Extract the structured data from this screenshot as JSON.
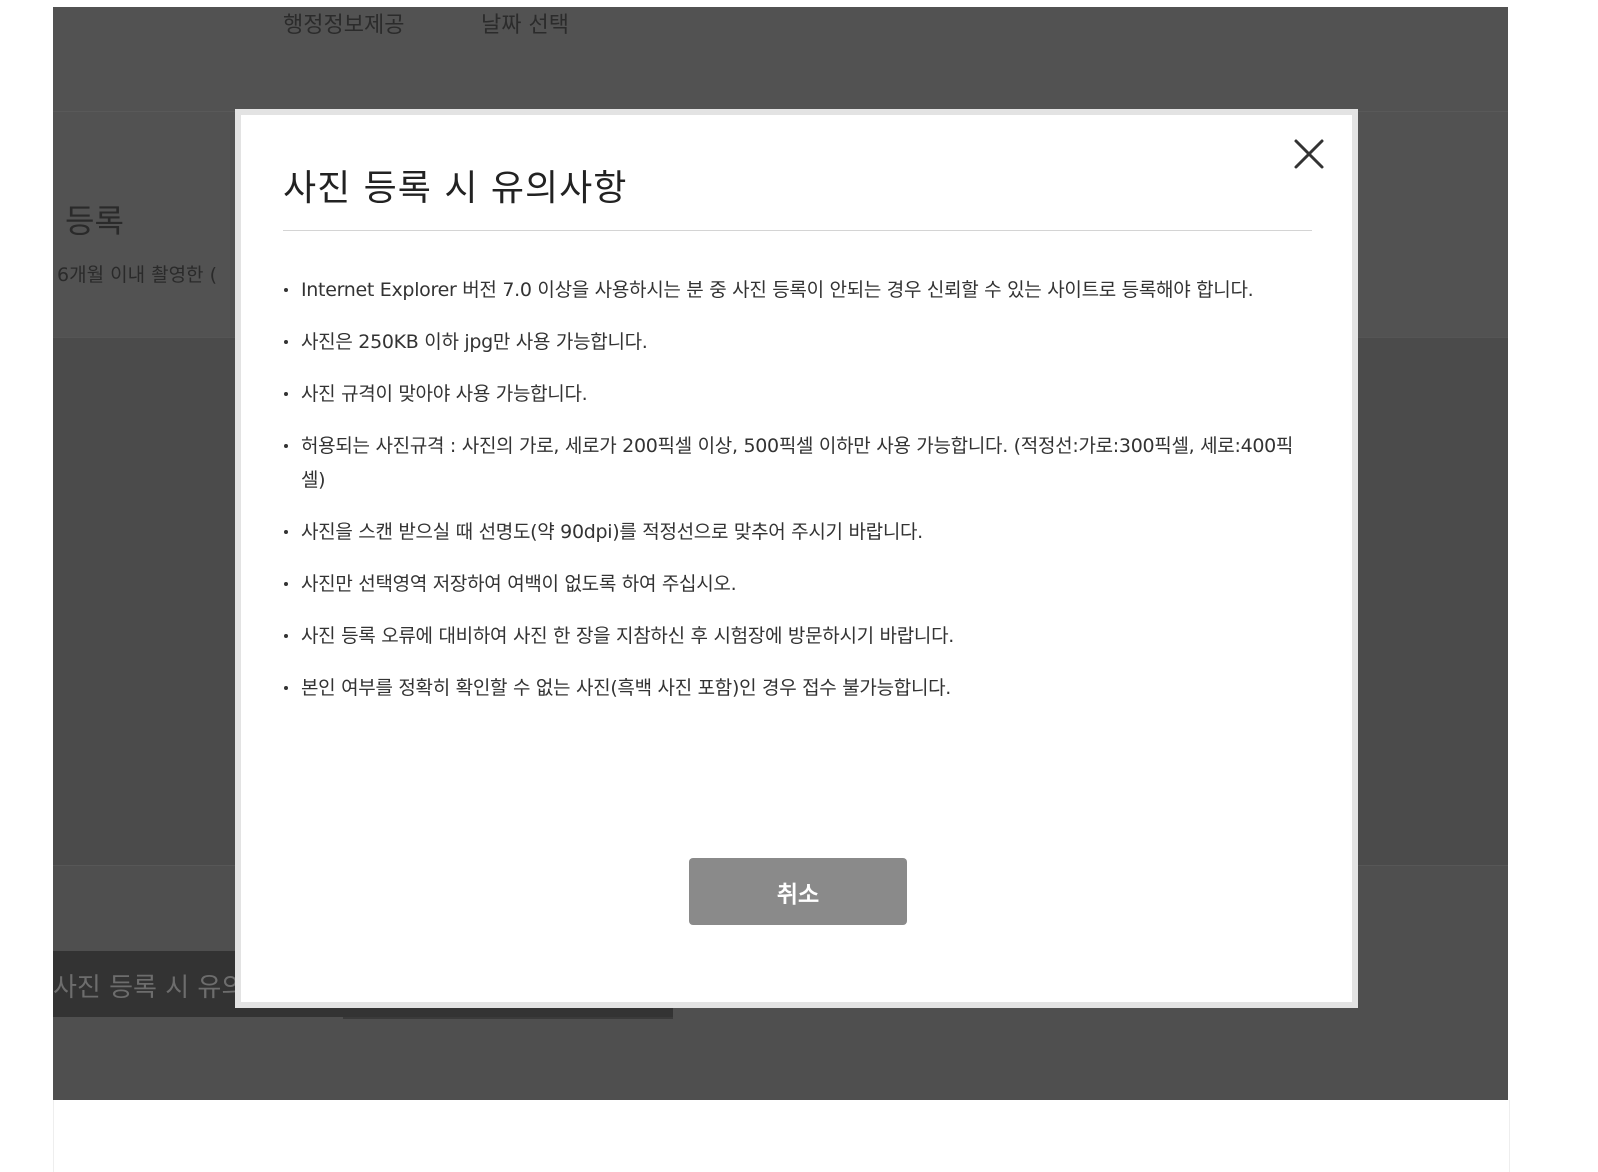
{
  "background": {
    "nav": {
      "items": [
        "행정정보제공",
        "날짜 선택"
      ]
    },
    "section_title": "등록",
    "section_subtitle": "6개월 이내 촬영한 (",
    "notice_bar_label": "사진 등록 시 유의"
  },
  "modal": {
    "title": "사진 등록 시 유의사항",
    "close_icon": "close-x-icon",
    "notices": [
      "Internet Explorer 버전 7.0 이상을 사용하시는 분 중 사진 등록이 안되는 경우 신뢰할 수 있는 사이트로 등록해야 합니다.",
      "사진은 250KB 이하 jpg만 사용 가능합니다.",
      "사진 규격이 맞아야 사용 가능합니다.",
      "허용되는 사진규격 : 사진의 가로, 세로가 200픽셀 이상, 500픽셀 이하만 사용 가능합니다. (적정선:가로:300픽셀, 세로:400픽셀)",
      "사진을 스캔 받으실 때 선명도(약 90dpi)를 적정선으로 맞추어 주시기 바랍니다.",
      "사진만 선택영역 저장하여 여백이 없도록 하여 주십시오.",
      "사진 등록 오류에 대비하여 사진 한 장을 지참하신 후 시험장에 방문하시기 바랍니다.",
      "본인 여부를 정확히 확인할 수 없는 사진(흑백 사진 포함)인 경우 접수 불가능합니다."
    ],
    "cancel_label": "취소"
  },
  "colors": {
    "overlay": "#4d4d4d",
    "cancel_button": "#8a8a8a",
    "modal_border": "#e3e3e3",
    "text": "#333333"
  }
}
